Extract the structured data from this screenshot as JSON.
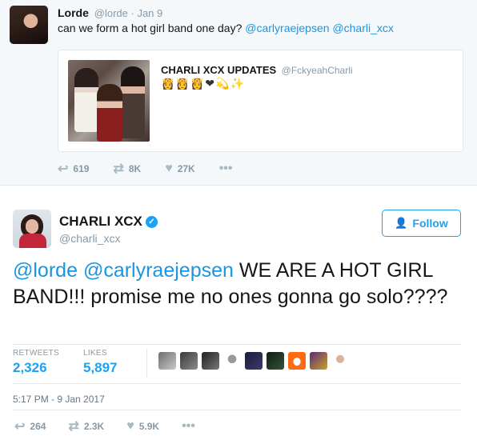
{
  "parent_tweet": {
    "display_name": "Lorde",
    "handle_time": "@lorde · Jan 9",
    "text_prefix": "can we form a hot girl band one day? ",
    "mention_1": "@carlyraejepsen",
    "mention_2": "@charli_xcx",
    "quote": {
      "display_name": "CHARLI XCX UPDATES",
      "handle": "@FckyeahCharli",
      "emojis": "👸👸👸❤💫✨"
    },
    "actions": {
      "reply_count": "619",
      "retweet_count": "8K",
      "like_count": "27K"
    }
  },
  "main_tweet": {
    "display_name": "CHARLI XCX",
    "verified_glyph": "✓",
    "handle": "@charli_xcx",
    "follow_label": "Follow",
    "text_mention_1": "@lorde",
    "text_mention_2": "@carlyraejepsen",
    "text_body": " WE ARE A HOT GIRL BAND!!! promise me no ones gonna go solo????",
    "stats": {
      "retweets_label": "RETWEETS",
      "retweets_value": "2,326",
      "likes_label": "LIKES",
      "likes_value": "5,897"
    },
    "timestamp": "5:17 PM - 9 Jan 2017",
    "actions": {
      "reply_count": "264",
      "retweet_count": "2.3K",
      "like_count": "5.9K"
    }
  },
  "icons": {
    "reply": "reply-icon",
    "retweet": "retweet-icon",
    "like": "heart-icon",
    "more": "more-icon",
    "follow": "add-user-icon",
    "verified": "verified-icon"
  },
  "colors": {
    "accent": "#1da1f2",
    "mention": "#1b95e0",
    "muted": "#8899a6",
    "parent_bg": "#f5f8fa"
  }
}
